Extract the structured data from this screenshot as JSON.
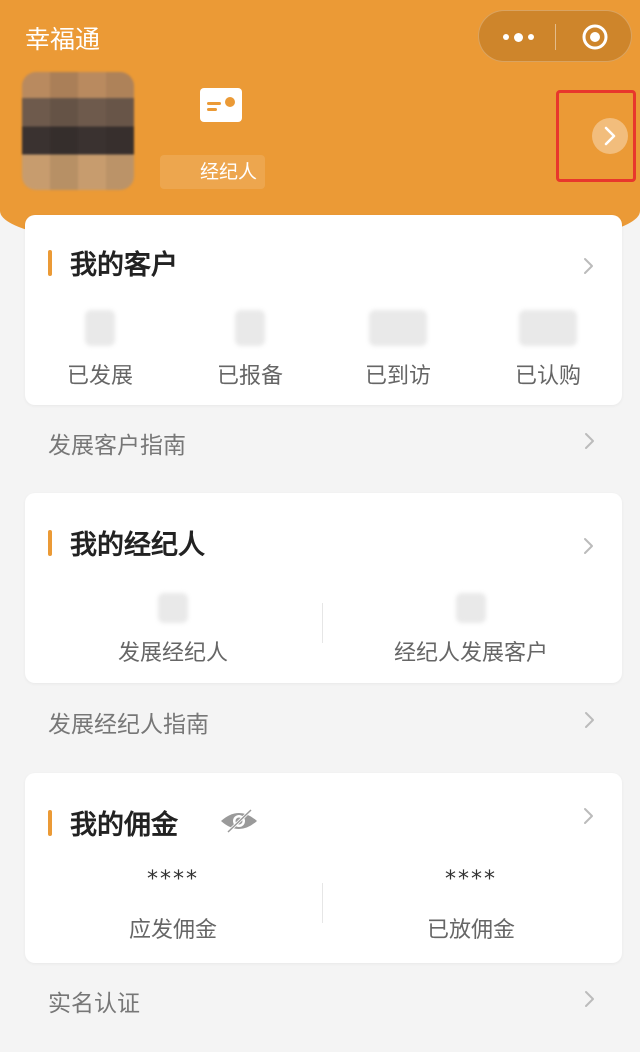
{
  "header": {
    "app_title": "幸福通",
    "agent_badge": "经纪人"
  },
  "my_customers": {
    "title": "我的客户",
    "stats": [
      {
        "label": "已发展"
      },
      {
        "label": "已报备"
      },
      {
        "label": "已到访"
      },
      {
        "label": "已认购"
      }
    ],
    "guide": "发展客户指南"
  },
  "my_agents": {
    "title": "我的经纪人",
    "stats": [
      {
        "label": "发展经纪人"
      },
      {
        "label": "经纪人发展客户"
      }
    ],
    "guide": "发展经纪人指南"
  },
  "my_commission": {
    "title": "我的佣金",
    "stats": [
      {
        "value": "****",
        "label": "应发佣金"
      },
      {
        "value": "****",
        "label": "已放佣金"
      }
    ]
  },
  "real_name": {
    "label": "实名认证"
  },
  "colors": {
    "brand": "#eb9a36",
    "highlight_frame": "#e8372c"
  }
}
